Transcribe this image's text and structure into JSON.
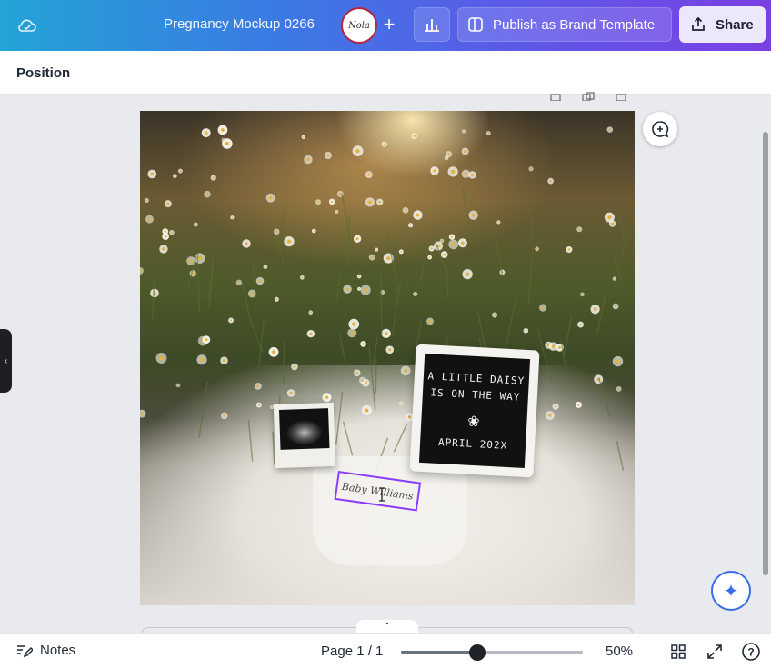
{
  "header": {
    "doc_title": "Pregnancy Mockup 0266",
    "avatar_text": "Nola",
    "publish_label": "Publish as Brand Template",
    "share_label": "Share"
  },
  "panel": {
    "title": "Position"
  },
  "design": {
    "letterboard": {
      "line1": "A LITTLE DAISY",
      "line2": "IS ON THE WAY",
      "flower": "❀",
      "line3": "APRIL 202X"
    },
    "selected_text": "Baby Williams"
  },
  "footer": {
    "notes_label": "Notes",
    "page_indicator": "Page 1 / 1",
    "zoom_value": "50%",
    "zoom_fraction": 0.42
  },
  "colors": {
    "selection": "#8b3dff",
    "magic_accent": "#3b6fe4"
  }
}
